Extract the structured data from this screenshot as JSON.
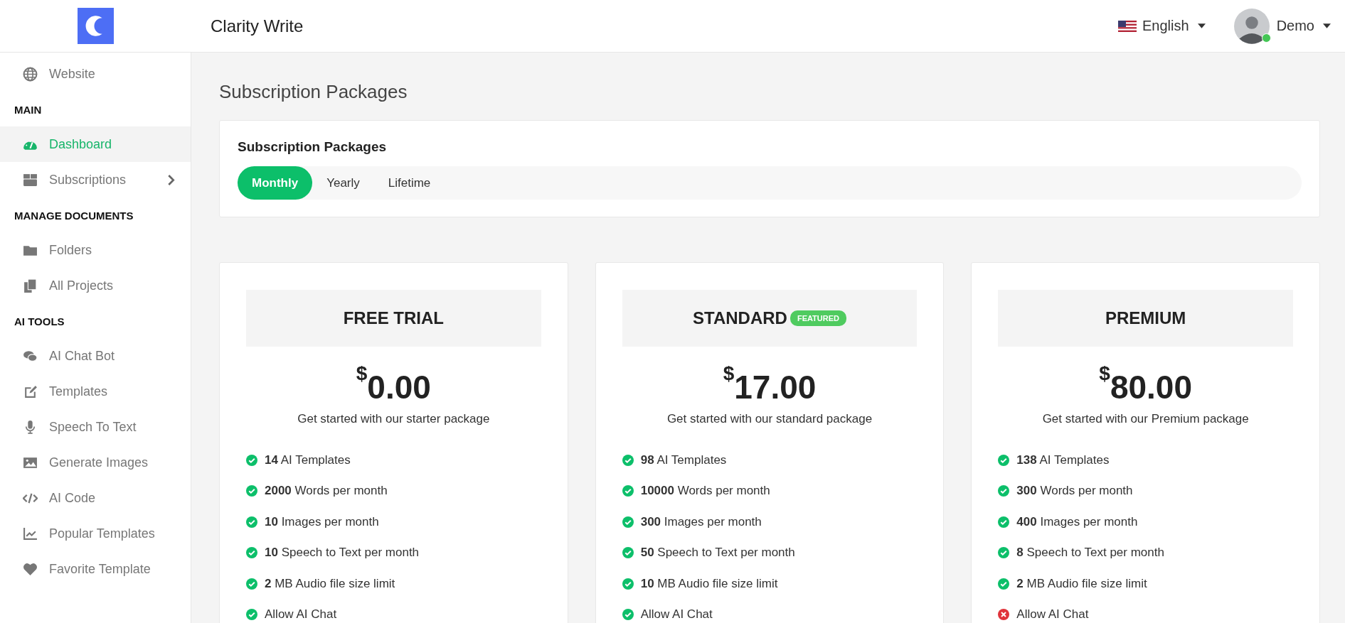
{
  "header": {
    "app_name": "Clarity Write",
    "language": "English",
    "user": "Demo",
    "user_online": true
  },
  "sidebar": {
    "top_items": [
      {
        "label": "Website",
        "kind": "globe",
        "selected": false
      }
    ],
    "sections": [
      {
        "title": "MAIN",
        "items": [
          {
            "label": "Dashboard",
            "kind": "dashboard",
            "selected": true
          },
          {
            "label": "Subscriptions",
            "kind": "box",
            "selected": false,
            "expanded": false
          }
        ]
      },
      {
        "title": "MANAGE DOCUMENTS",
        "items": [
          {
            "label": "Folders",
            "kind": "folder",
            "selected": false
          },
          {
            "label": "All Projects",
            "kind": "copy",
            "selected": false
          }
        ]
      },
      {
        "title": "AI TOOLS",
        "items": [
          {
            "label": "AI Chat Bot",
            "kind": "chat",
            "selected": false
          },
          {
            "label": "Templates",
            "kind": "edit",
            "selected": false
          },
          {
            "label": "Speech To Text",
            "kind": "mic",
            "selected": false
          },
          {
            "label": "Generate Images",
            "kind": "image",
            "selected": false
          },
          {
            "label": "AI Code",
            "kind": "code",
            "selected": false
          },
          {
            "label": "Popular Templates",
            "kind": "chart",
            "selected": false
          },
          {
            "label": "Favorite Template",
            "kind": "heart",
            "selected": false
          }
        ]
      }
    ]
  },
  "page_title": "Subscription Packages",
  "packages_card": {
    "title": "Subscription Packages",
    "tabs": [
      {
        "label": "Monthly",
        "selected": true
      },
      {
        "label": "Yearly",
        "selected": false
      },
      {
        "label": "Lifetime",
        "selected": false
      }
    ]
  },
  "plans": [
    {
      "name": "FREE TRIAL",
      "currency": "$",
      "amount": "0.00",
      "description": "Get started with our starter package",
      "features": [
        {
          "text": "**14** AI Templates",
          "included": true
        },
        {
          "text": "**2000** Words per month",
          "included": true
        },
        {
          "text": "**10** Images per month",
          "included": true
        },
        {
          "text": "**10** Speech to Text per month",
          "included": true
        },
        {
          "text": "**2** MB Audio file size limit",
          "included": true
        },
        {
          "text": "Allow AI Chat",
          "included": true
        }
      ]
    },
    {
      "name": "STANDARD",
      "badge": "FEATURED",
      "currency": "$",
      "amount": "17.00",
      "description": "Get started with our standard package",
      "features": [
        {
          "text": "**98** AI Templates",
          "included": true
        },
        {
          "text": "**10000** Words per month",
          "included": true
        },
        {
          "text": "**300** Images per month",
          "included": true
        },
        {
          "text": "**50** Speech to Text per month",
          "included": true
        },
        {
          "text": "**10** MB Audio file size limit",
          "included": true
        },
        {
          "text": "Allow AI Chat",
          "included": true
        }
      ]
    },
    {
      "name": "PREMIUM",
      "currency": "$",
      "amount": "80.00",
      "description": "Get started with our Premium package",
      "features": [
        {
          "text": "**138** AI Templates",
          "included": true
        },
        {
          "text": "**300** Words per month",
          "included": true
        },
        {
          "text": "**400** Images per month",
          "included": true
        },
        {
          "text": "**8** Speech to Text per month",
          "included": true
        },
        {
          "text": "**2** MB Audio file size limit",
          "included": true
        },
        {
          "text": "Allow AI Chat",
          "included": false
        }
      ]
    }
  ]
}
